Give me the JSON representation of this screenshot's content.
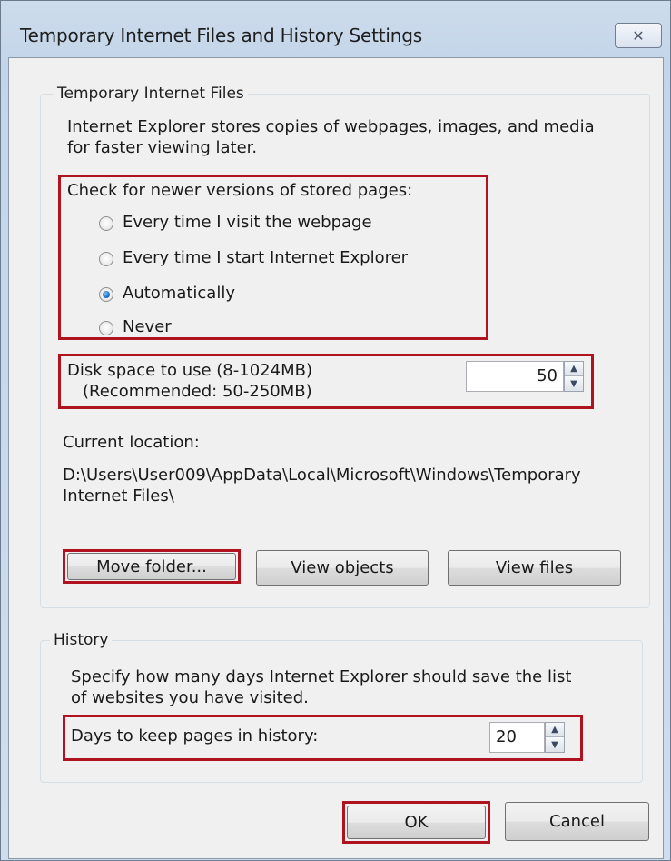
{
  "window": {
    "title": "Temporary Internet Files and History Settings",
    "close_glyph": "✕"
  },
  "temp_files": {
    "group_label": "Temporary Internet Files",
    "description_line1": "Internet Explorer stores copies of webpages, images, and media",
    "description_line2": "for faster viewing later.",
    "check_label": "Check for newer versions of stored pages:",
    "options": [
      {
        "label": "Every time I visit the webpage",
        "selected": false
      },
      {
        "label": "Every time I start Internet Explorer",
        "selected": false
      },
      {
        "label": "Automatically",
        "selected": true
      },
      {
        "label": "Never",
        "selected": false
      }
    ],
    "disk_space_label": "Disk space to use (8-1024MB)",
    "disk_space_recommended": "(Recommended: 50-250MB)",
    "disk_space_value": "50",
    "current_location_label": "Current location:",
    "current_location_line1": "D:\\Users\\User009\\AppData\\Local\\Microsoft\\Windows\\Temporary",
    "current_location_line2": "Internet Files\\",
    "move_folder_label": "Move folder...",
    "view_objects_label": "View objects",
    "view_files_label": "View files"
  },
  "history": {
    "group_label": "History",
    "description_line1": "Specify how many days Internet Explorer should save the list",
    "description_line2": "of websites you have visited.",
    "days_label": "Days to keep pages in history:",
    "days_value": "20"
  },
  "footer": {
    "ok_label": "OK",
    "cancel_label": "Cancel"
  },
  "colors": {
    "highlight_border": "#b0121f",
    "window_frame": "#c3d5e9",
    "dialog_background": "#f0f0f0"
  }
}
